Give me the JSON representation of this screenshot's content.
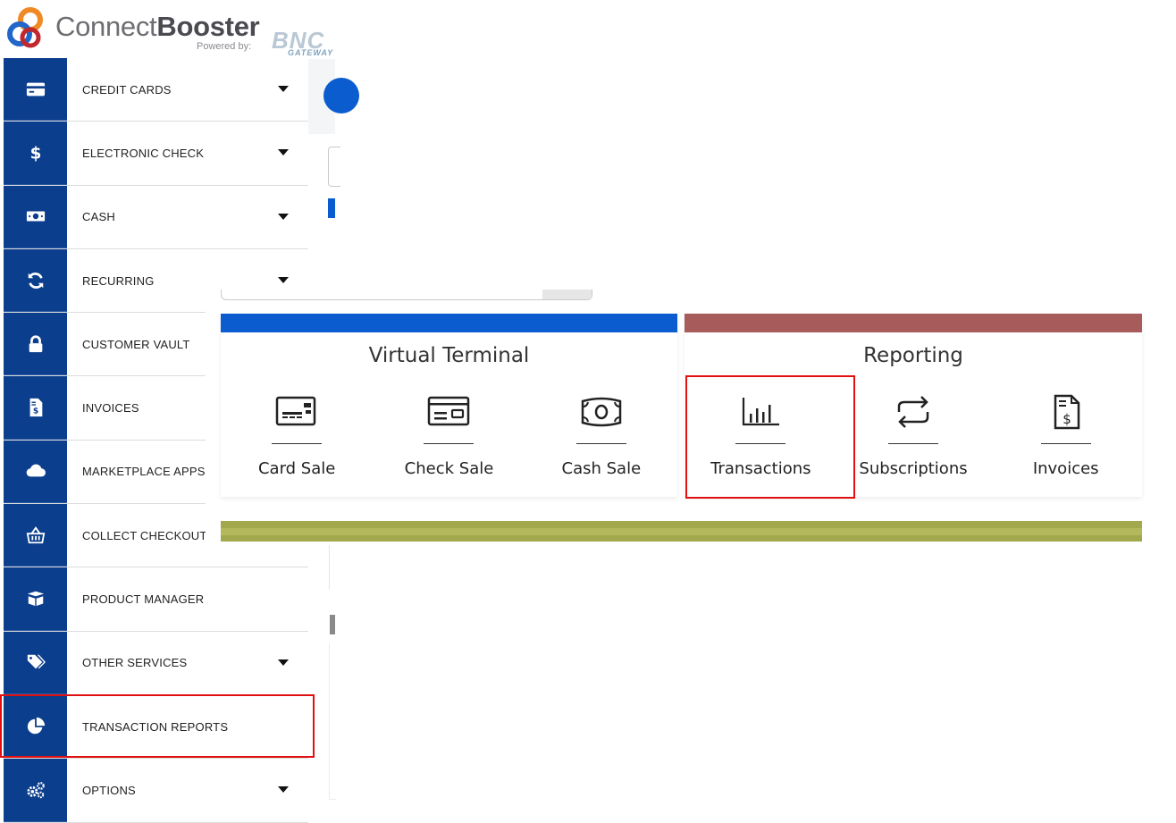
{
  "brand": {
    "name_light": "Connect",
    "name_bold": "Booster",
    "powered_by": "Powered by:",
    "partner": "BNC",
    "partner_sub": "GATEWAY",
    "colors": {
      "navy": "#0b3e8c",
      "blue": "#0b5ccf",
      "maroon": "#a85b5b",
      "olive": "#a2a84c",
      "highlight": "#e01010"
    }
  },
  "sidebar": {
    "items": [
      {
        "label": "CREDIT CARDS",
        "icon": "credit-card-icon",
        "has_caret": true
      },
      {
        "label": "ELECTRONIC CHECK",
        "icon": "dollar-icon",
        "has_caret": true
      },
      {
        "label": "CASH",
        "icon": "cash-icon",
        "has_caret": true
      },
      {
        "label": "RECURRING",
        "icon": "refresh-icon",
        "has_caret": true
      },
      {
        "label": "CUSTOMER VAULT",
        "icon": "lock-icon",
        "has_caret": false
      },
      {
        "label": "INVOICES",
        "icon": "invoice-icon",
        "has_caret": false
      },
      {
        "label": "MARKETPLACE APPS",
        "icon": "cloud-icon",
        "has_caret": false
      },
      {
        "label": "COLLECT CHECKOUT",
        "icon": "basket-icon",
        "has_caret": false
      },
      {
        "label": "PRODUCT MANAGER",
        "icon": "box-icon",
        "has_caret": false
      },
      {
        "label": "OTHER SERVICES",
        "icon": "tags-icon",
        "has_caret": true
      },
      {
        "label": "TRANSACTION REPORTS",
        "icon": "pie-chart-icon",
        "has_caret": false,
        "highlighted": true
      },
      {
        "label": "OPTIONS",
        "icon": "gears-icon",
        "has_caret": true
      }
    ]
  },
  "dashboard": {
    "virtual_terminal": {
      "title": "Virtual Terminal",
      "tiles": [
        {
          "label": "Card Sale",
          "icon": "card-reader-icon"
        },
        {
          "label": "Check Sale",
          "icon": "check-icon"
        },
        {
          "label": "Cash Sale",
          "icon": "banknote-icon"
        }
      ]
    },
    "reporting": {
      "title": "Reporting",
      "tiles": [
        {
          "label": "Transactions",
          "icon": "bar-chart-icon",
          "highlighted": true
        },
        {
          "label": "Subscriptions",
          "icon": "repeat-icon"
        },
        {
          "label": "Invoices",
          "icon": "invoice-dollar-icon"
        }
      ]
    }
  }
}
